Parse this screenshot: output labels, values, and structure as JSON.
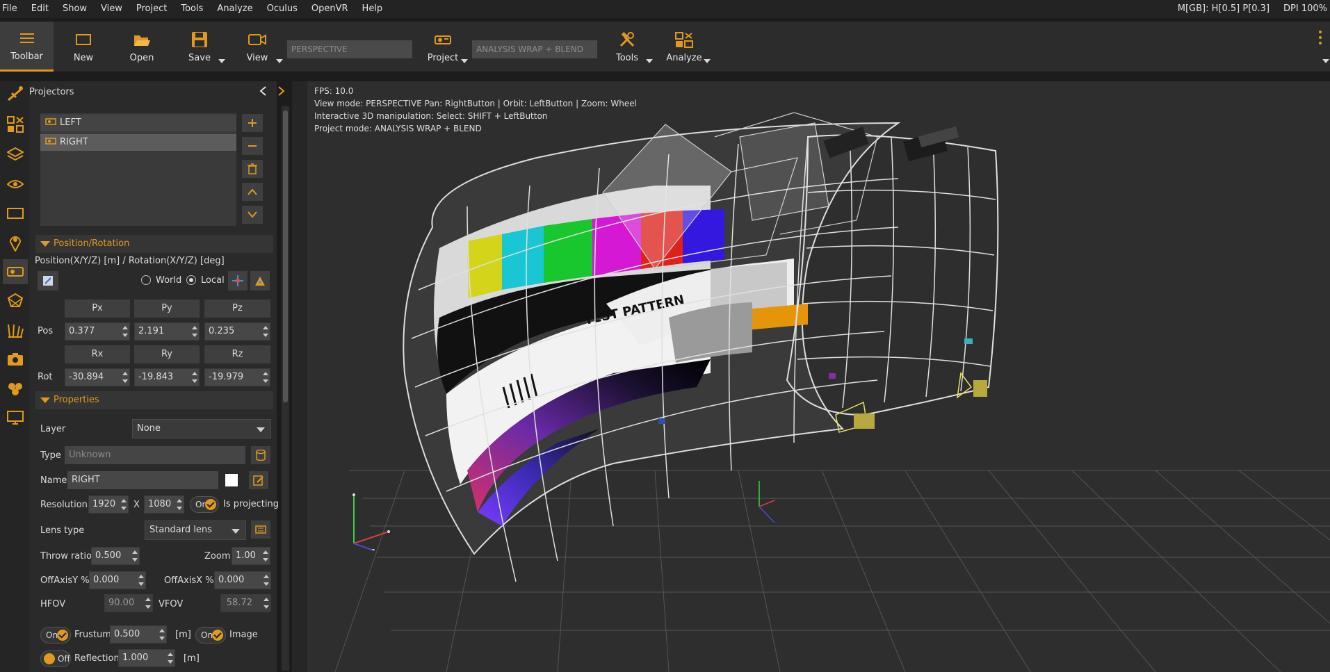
{
  "menu": [
    "File",
    "Edit",
    "Show",
    "View",
    "Project",
    "Tools",
    "Analyze",
    "Oculus",
    "OpenVR",
    "Help"
  ],
  "status": {
    "memory": "M[GB]: H[0.5] P[0.3]",
    "dpi": "DPI 100%"
  },
  "toolbar": {
    "toolbar_label": "Toolbar",
    "new_label": "New",
    "open_label": "Open",
    "save_label": "Save",
    "view_label": "View",
    "view_mode": "PERSPECTIVE",
    "project_label": "Project",
    "project_mode": "ANALYSIS WRAP + BLEND",
    "tools_label": "Tools",
    "analyze_label": "Analyze"
  },
  "panel": {
    "title": "Projectors",
    "projectors": [
      "LEFT",
      "RIGHT"
    ],
    "selected": "RIGHT",
    "position_section": "Position/Rotation",
    "position_caption": "Position(X/Y/Z) [m] / Rotation(X/Y/Z) [deg]",
    "world_label": "World",
    "local_label": "Local",
    "coord_mode": "Local",
    "pos_headers": [
      "Px",
      "Py",
      "Pz"
    ],
    "rot_headers": [
      "Rx",
      "Ry",
      "Rz"
    ],
    "pos_label": "Pos",
    "rot_label": "Rot",
    "pos": [
      "0.377",
      "2.191",
      "0.235"
    ],
    "rot": [
      "-30.894",
      "-19.843",
      "-19.979"
    ],
    "properties_section": "Properties",
    "layer_label": "Layer",
    "layer_value": "None",
    "type_label": "Type",
    "type_value": "Unknown",
    "name_label": "Name",
    "name_value": "RIGHT",
    "resolution_label": "Resolution",
    "res_w": "1920",
    "res_x": "X",
    "res_h": "1080",
    "on_label": "On",
    "is_projecting_label": "Is projecting",
    "lens_label": "Lens type",
    "lens_value": "Standard lens",
    "throw_label": "Throw ratio",
    "throw_value": "0.500",
    "zoom_label": "Zoom",
    "zoom_value": "1.00",
    "offy_label": "OffAxisY %",
    "offy_value": "0.000",
    "offx_label": "OffAxisX %",
    "offx_value": "0.000",
    "hfov_label": "HFOV",
    "hfov_value": "90.00",
    "vfov_label": "VFOV",
    "vfov_value": "58.72",
    "frustum_toggle": "On",
    "frustum_label": "Frustum",
    "frustum_value": "0.500",
    "frustum_unit": "[m]",
    "image_toggle": "On",
    "image_label": "Image",
    "reflection_toggle": "Off",
    "reflection_label": "Reflection",
    "reflection_value": "1.000",
    "reflection_unit": "[m]"
  },
  "viewport": {
    "fps": "FPS: 10.0",
    "line2": "View mode: PERSPECTIVE Pan: RightButton | Orbit: LeftButton | Zoom: Wheel",
    "line3": "Interactive 3D manipulation: Select: SHIFT + LeftButton",
    "line4": "Project mode: ANALYSIS WRAP + BLEND",
    "pattern_text": "TEST PATTERN"
  },
  "colors": {
    "accent": "#e09a1f",
    "bg": "#1c1c1c",
    "panel": "#2a2a2a",
    "viewport": "#2e2e2e"
  }
}
